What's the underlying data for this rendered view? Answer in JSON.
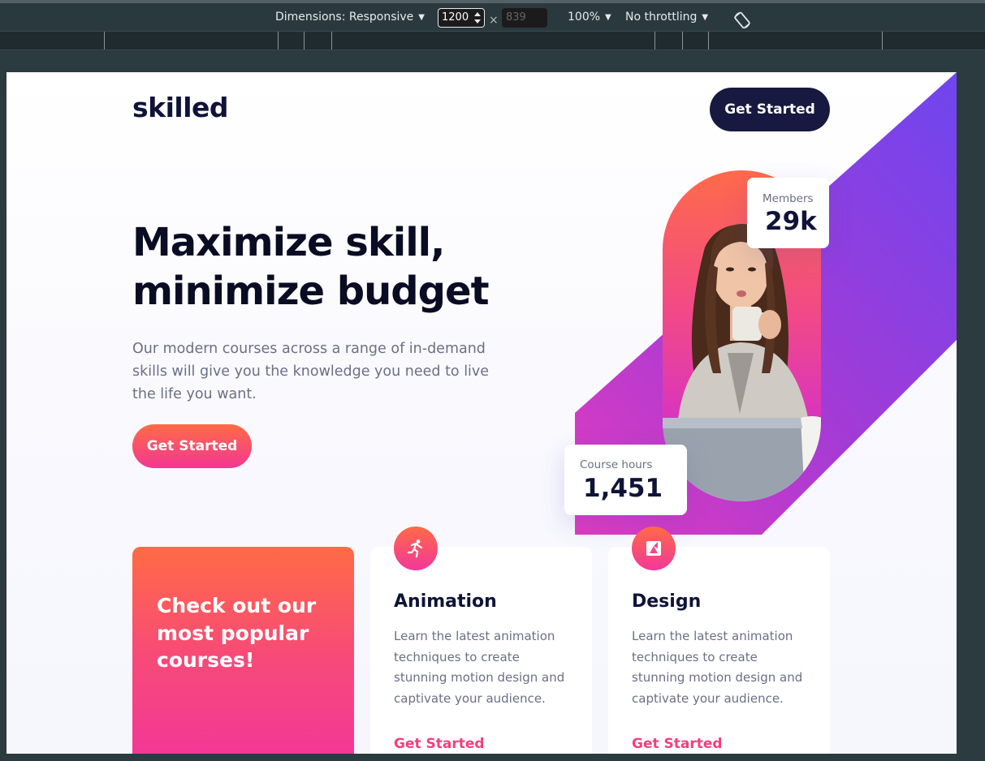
{
  "devtools": {
    "dimensions_label": "Dimensions: Responsive",
    "width_value": "1200",
    "height_placeholder": "839",
    "times": "×",
    "zoom": "100%",
    "throttling": "No throttling",
    "rotate_icon": "rotate-icon"
  },
  "site": {
    "logo": "skilled",
    "header_cta": "Get Started",
    "hero": {
      "title_line1": "Maximize skill,",
      "title_line2": "minimize budget",
      "text": "Our modern courses across a range of in-demand skills will give you the knowledge you need to live the life you want.",
      "cta": "Get Started"
    },
    "stats": {
      "members_label": "Members",
      "members_value": "29k",
      "hours_label": "Course hours",
      "hours_value": "1,451"
    },
    "promo": {
      "text": "Check out our most popular courses!"
    },
    "courses": [
      {
        "icon": "running-person-icon",
        "title": "Animation",
        "text": "Learn the latest animation techniques to create stunning motion design and captivate your audience.",
        "link": "Get Started"
      },
      {
        "icon": "design-icon",
        "title": "Design",
        "text": "Learn the latest animation techniques to create stunning motion design and captivate your audience.",
        "link": "Get Started"
      }
    ]
  },
  "colors": {
    "brand_dark": "#171940",
    "accent_orange": "#ff6b45",
    "accent_pink": "#f43693",
    "accent_purple": "#6b46f0"
  }
}
